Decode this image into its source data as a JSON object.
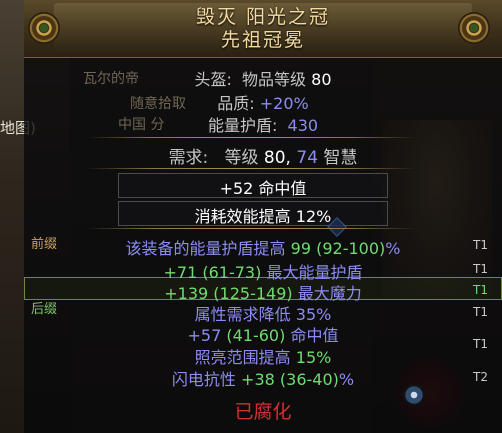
{
  "item": {
    "title_line1": "毁灭  阳光之冠",
    "title_line2": "先祖冠冕",
    "type_row": {
      "label": "头盔:",
      "ilvl_label": "物品等级",
      "ilvl_value": "80"
    },
    "quality_row": {
      "label": "品质:",
      "value": "+20%"
    },
    "energy_shield_row": {
      "label": "能量护盾:",
      "value": "430"
    },
    "requirements_row": {
      "label": "需求:",
      "level_label": "等级",
      "level_value": "80,",
      "int_value": "74",
      "int_label": "智慧"
    },
    "implicits": [
      {
        "text": "+52 命中值"
      },
      {
        "text": "消耗效能提高 12%"
      }
    ],
    "mods": [
      {
        "prefix": "该装备的能量护盾提高",
        "value": "99",
        "range": "(92-100)",
        "suffix": "%",
        "tier": "T1"
      },
      {
        "prefix": "+71",
        "range": "(61-73)",
        "suffix": "最大能量护盾",
        "tier": "T1"
      },
      {
        "prefix": "+139",
        "range": "(125-149)",
        "suffix": "最大魔力",
        "tier": "T1"
      },
      {
        "text": "属性需求降低 35%",
        "tier": "T1"
      },
      {
        "prefix": "+57",
        "range": "(41-60)",
        "suffix": "命中值",
        "tier": ""
      },
      {
        "prefix": "照亮范围提高",
        "value": "15%",
        "tier": "T1"
      },
      {
        "prefix": "闪电抗性",
        "value": "+38",
        "range": "(36-40)",
        "suffix": "%",
        "tier": "T2"
      }
    ],
    "side_labels": {
      "prefix": "前缀",
      "suffix": "后缀"
    },
    "corrupted": "已腐化"
  },
  "background": {
    "map_label": "地图)",
    "ghost_lines": [
      "瓦尔的帝",
      "随意拾取",
      "中国 分"
    ]
  },
  "colors": {
    "title": "#f4d9a1",
    "magic_blue": "#8c8cf2",
    "range_green": "#6fdc6f",
    "corrupted_red": "#d23030",
    "header_gold": "#5a4a2a"
  }
}
